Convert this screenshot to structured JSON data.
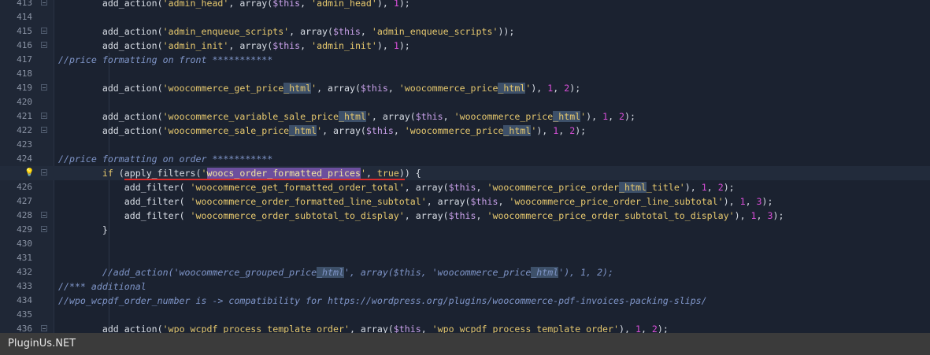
{
  "editor": {
    "lines": [
      {
        "n": "413",
        "fold": true,
        "segs": [
          [
            "        ",
            ""
          ],
          [
            "add_action(",
            "fn"
          ],
          [
            "'admin_head'",
            "str"
          ],
          [
            ", array(",
            "fn"
          ],
          [
            "$this",
            "var"
          ],
          [
            ", ",
            "fn"
          ],
          [
            "'admin_head'",
            "str"
          ],
          [
            "), ",
            "fn"
          ],
          [
            "1",
            "num"
          ],
          [
            ");",
            "fn"
          ]
        ]
      },
      {
        "n": "414",
        "fold": false,
        "segs": []
      },
      {
        "n": "415",
        "fold": true,
        "segs": [
          [
            "        ",
            ""
          ],
          [
            "add_action(",
            "fn"
          ],
          [
            "'admin_enqueue_scripts'",
            "str"
          ],
          [
            ", array(",
            "fn"
          ],
          [
            "$this",
            "var"
          ],
          [
            ", ",
            "fn"
          ],
          [
            "'admin_enqueue_scripts'",
            "str"
          ],
          [
            "));",
            "fn"
          ]
        ]
      },
      {
        "n": "416",
        "fold": true,
        "segs": [
          [
            "        ",
            ""
          ],
          [
            "add_action(",
            "fn"
          ],
          [
            "'admin_init'",
            "str"
          ],
          [
            ", array(",
            "fn"
          ],
          [
            "$this",
            "var"
          ],
          [
            ", ",
            "fn"
          ],
          [
            "'admin_init'",
            "str"
          ],
          [
            "), ",
            "fn"
          ],
          [
            "1",
            "num"
          ],
          [
            ");",
            "fn"
          ]
        ]
      },
      {
        "n": "417",
        "fold": false,
        "segs": [
          [
            "//price formatting on front ***********",
            "cm"
          ]
        ]
      },
      {
        "n": "418",
        "fold": false,
        "segs": []
      },
      {
        "n": "419",
        "fold": true,
        "segs": [
          [
            "        ",
            ""
          ],
          [
            "add_action(",
            "fn"
          ],
          [
            "'woocommerce_get_price",
            "str"
          ],
          [
            "_html",
            "str hl"
          ],
          [
            "'",
            "str"
          ],
          [
            ", array(",
            "fn"
          ],
          [
            "$this",
            "var"
          ],
          [
            ", ",
            "fn"
          ],
          [
            "'woocommerce_price",
            "str"
          ],
          [
            "_html",
            "str hl"
          ],
          [
            "'",
            "str"
          ],
          [
            "), ",
            "fn"
          ],
          [
            "1",
            "num"
          ],
          [
            ", ",
            "fn"
          ],
          [
            "2",
            "num"
          ],
          [
            ");",
            "fn"
          ]
        ]
      },
      {
        "n": "420",
        "fold": false,
        "segs": []
      },
      {
        "n": "421",
        "fold": true,
        "segs": [
          [
            "        ",
            ""
          ],
          [
            "add_action(",
            "fn"
          ],
          [
            "'woocommerce_variable_sale_price",
            "str"
          ],
          [
            "_html",
            "str hl"
          ],
          [
            "'",
            "str"
          ],
          [
            ", array(",
            "fn"
          ],
          [
            "$this",
            "var"
          ],
          [
            ", ",
            "fn"
          ],
          [
            "'woocommerce_price",
            "str"
          ],
          [
            "_html",
            "str hl"
          ],
          [
            "'",
            "str"
          ],
          [
            "), ",
            "fn"
          ],
          [
            "1",
            "num"
          ],
          [
            ", ",
            "fn"
          ],
          [
            "2",
            "num"
          ],
          [
            ");",
            "fn"
          ]
        ]
      },
      {
        "n": "422",
        "fold": true,
        "segs": [
          [
            "        ",
            ""
          ],
          [
            "add_action(",
            "fn"
          ],
          [
            "'woocommerce_sale_price",
            "str"
          ],
          [
            "_html",
            "str hl"
          ],
          [
            "'",
            "str"
          ],
          [
            ", array(",
            "fn"
          ],
          [
            "$this",
            "var"
          ],
          [
            ", ",
            "fn"
          ],
          [
            "'woocommerce_price",
            "str"
          ],
          [
            "_html",
            "str hl"
          ],
          [
            "'",
            "str"
          ],
          [
            "), ",
            "fn"
          ],
          [
            "1",
            "num"
          ],
          [
            ", ",
            "fn"
          ],
          [
            "2",
            "num"
          ],
          [
            ");",
            "fn"
          ]
        ]
      },
      {
        "n": "423",
        "fold": false,
        "segs": []
      },
      {
        "n": "424",
        "fold": false,
        "segs": [
          [
            "//price formatting on order ***********",
            "cm"
          ]
        ]
      },
      {
        "n": "",
        "fold": true,
        "bulb": true,
        "current": true,
        "segs": [
          [
            "        ",
            ""
          ],
          [
            "if",
            "kw"
          ],
          [
            " (",
            "fn"
          ],
          [
            "apply_filters(",
            "fn err"
          ],
          [
            "'",
            "str err"
          ],
          [
            "woocs_order_formatted_prices",
            "sel err"
          ],
          [
            "'",
            "str err"
          ],
          [
            ", ",
            "fn err"
          ],
          [
            "true",
            "kw err"
          ],
          [
            ")",
            "fn err"
          ],
          [
            ") {",
            "fn"
          ]
        ]
      },
      {
        "n": "426",
        "fold": false,
        "segs": [
          [
            "            ",
            ""
          ],
          [
            "add_filter( ",
            "fn"
          ],
          [
            "'woocommerce_get_formatted_order_total'",
            "str"
          ],
          [
            ", array(",
            "fn"
          ],
          [
            "$this",
            "var"
          ],
          [
            ", ",
            "fn"
          ],
          [
            "'woocommerce_price_order",
            "str"
          ],
          [
            "_html",
            "str hl"
          ],
          [
            "_title'",
            "str"
          ],
          [
            "), ",
            "fn"
          ],
          [
            "1",
            "num"
          ],
          [
            ", ",
            "fn"
          ],
          [
            "2",
            "num"
          ],
          [
            ");",
            "fn"
          ]
        ]
      },
      {
        "n": "427",
        "fold": false,
        "segs": [
          [
            "            ",
            ""
          ],
          [
            "add_filter( ",
            "fn"
          ],
          [
            "'woocommerce_order_formatted_line_subtotal'",
            "str"
          ],
          [
            ", array(",
            "fn"
          ],
          [
            "$this",
            "var"
          ],
          [
            ", ",
            "fn"
          ],
          [
            "'woocommerce_price_order_line_subtotal'",
            "str"
          ],
          [
            "), ",
            "fn"
          ],
          [
            "1",
            "num"
          ],
          [
            ", ",
            "fn"
          ],
          [
            "3",
            "num"
          ],
          [
            ");",
            "fn"
          ]
        ]
      },
      {
        "n": "428",
        "fold": true,
        "segs": [
          [
            "            ",
            ""
          ],
          [
            "add_filter( ",
            "fn"
          ],
          [
            "'woocommerce_order_subtotal_to_display'",
            "str"
          ],
          [
            ", array(",
            "fn"
          ],
          [
            "$this",
            "var"
          ],
          [
            ", ",
            "fn"
          ],
          [
            "'woocommerce_price_order_subtotal_to_display'",
            "str"
          ],
          [
            "), ",
            "fn"
          ],
          [
            "1",
            "num"
          ],
          [
            ", ",
            "fn"
          ],
          [
            "3",
            "num"
          ],
          [
            ");",
            "fn"
          ]
        ]
      },
      {
        "n": "429",
        "fold": true,
        "segs": [
          [
            "        ",
            ""
          ],
          [
            "}",
            "fn"
          ]
        ]
      },
      {
        "n": "430",
        "fold": false,
        "segs": []
      },
      {
        "n": "431",
        "fold": false,
        "segs": []
      },
      {
        "n": "432",
        "fold": false,
        "segs": [
          [
            "        ",
            ""
          ],
          [
            "//add_action('woocommerce_grouped_price",
            "cm"
          ],
          [
            "_html",
            "cm hl"
          ],
          [
            "', array($this, 'woocommerce_price",
            "cm"
          ],
          [
            "_html",
            "cm hl"
          ],
          [
            "'), 1, 2);",
            "cm"
          ]
        ]
      },
      {
        "n": "433",
        "fold": false,
        "segs": [
          [
            "//*** additional",
            "cm"
          ]
        ]
      },
      {
        "n": "434",
        "fold": false,
        "segs": [
          [
            "//wpo_wcpdf_order_number is -> compatibility for https://wordpress.org/plugins/woocommerce-pdf-invoices-packing-slips/",
            "cm"
          ]
        ]
      },
      {
        "n": "435",
        "fold": false,
        "segs": []
      },
      {
        "n": "436",
        "fold": true,
        "segs": [
          [
            "        ",
            ""
          ],
          [
            "add_action(",
            "fn"
          ],
          [
            "'wpo_wcpdf_process_template_order'",
            "str"
          ],
          [
            ", array(",
            "fn"
          ],
          [
            "$this",
            "var"
          ],
          [
            ", ",
            "fn"
          ],
          [
            "'wpo_wcpdf_process_template_order'",
            "str"
          ],
          [
            "), ",
            "fn"
          ],
          [
            "1",
            "num"
          ],
          [
            ", ",
            "fn"
          ],
          [
            "2",
            "num"
          ],
          [
            ");",
            "fn"
          ]
        ]
      }
    ]
  },
  "statusbar": {
    "label": "PluginUs.NET"
  },
  "colors": {
    "background": "#1b2230",
    "string": "#e6c86e",
    "variable": "#c8a0e8",
    "number": "#d94fd9",
    "comment": "#7f95c8",
    "selection": "#6c4f9e",
    "error_underline": "#d92b2b"
  },
  "icons": {
    "bulb": "lightbulb-icon",
    "fold": "fold-toggle-icon"
  }
}
